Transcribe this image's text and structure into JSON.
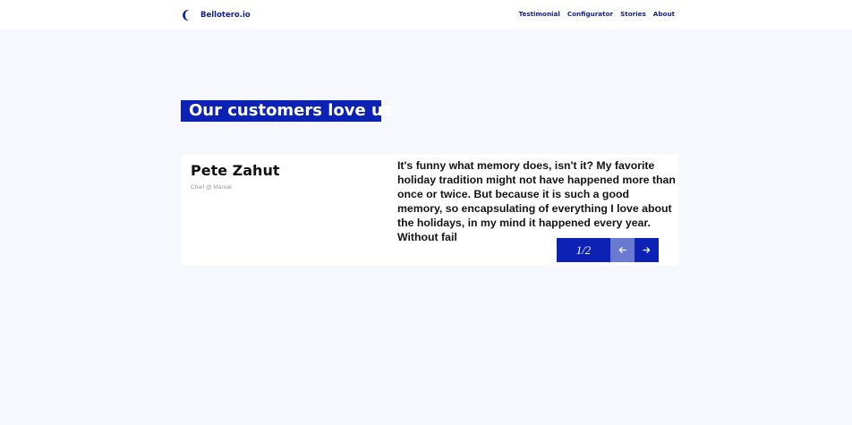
{
  "nav": {
    "brand": "Bellotero.io",
    "links": [
      "Testimonial",
      "Configurator",
      "Stories",
      "About"
    ]
  },
  "headline": "Our customers love us",
  "testimonial": {
    "name": "Pete Zahut",
    "role": "Chief @ Maniak",
    "quote": "It's funny what memory does, isn't it? My favorite holiday tradition might not have happened more than once or twice. But because it is such a good memory, so encapsulating of everything I love about the holidays, in my mind it happened every year. Without fail",
    "pager": "1/2"
  },
  "icons": {
    "logo": "crescent-logo-icon",
    "prev": "arrow-left-icon",
    "next": "arrow-right-icon"
  },
  "colors": {
    "accent": "#0b22b5",
    "accent_light": "#6a7ad0",
    "background": "#f7f8fe",
    "nav_text": "#14238f"
  }
}
